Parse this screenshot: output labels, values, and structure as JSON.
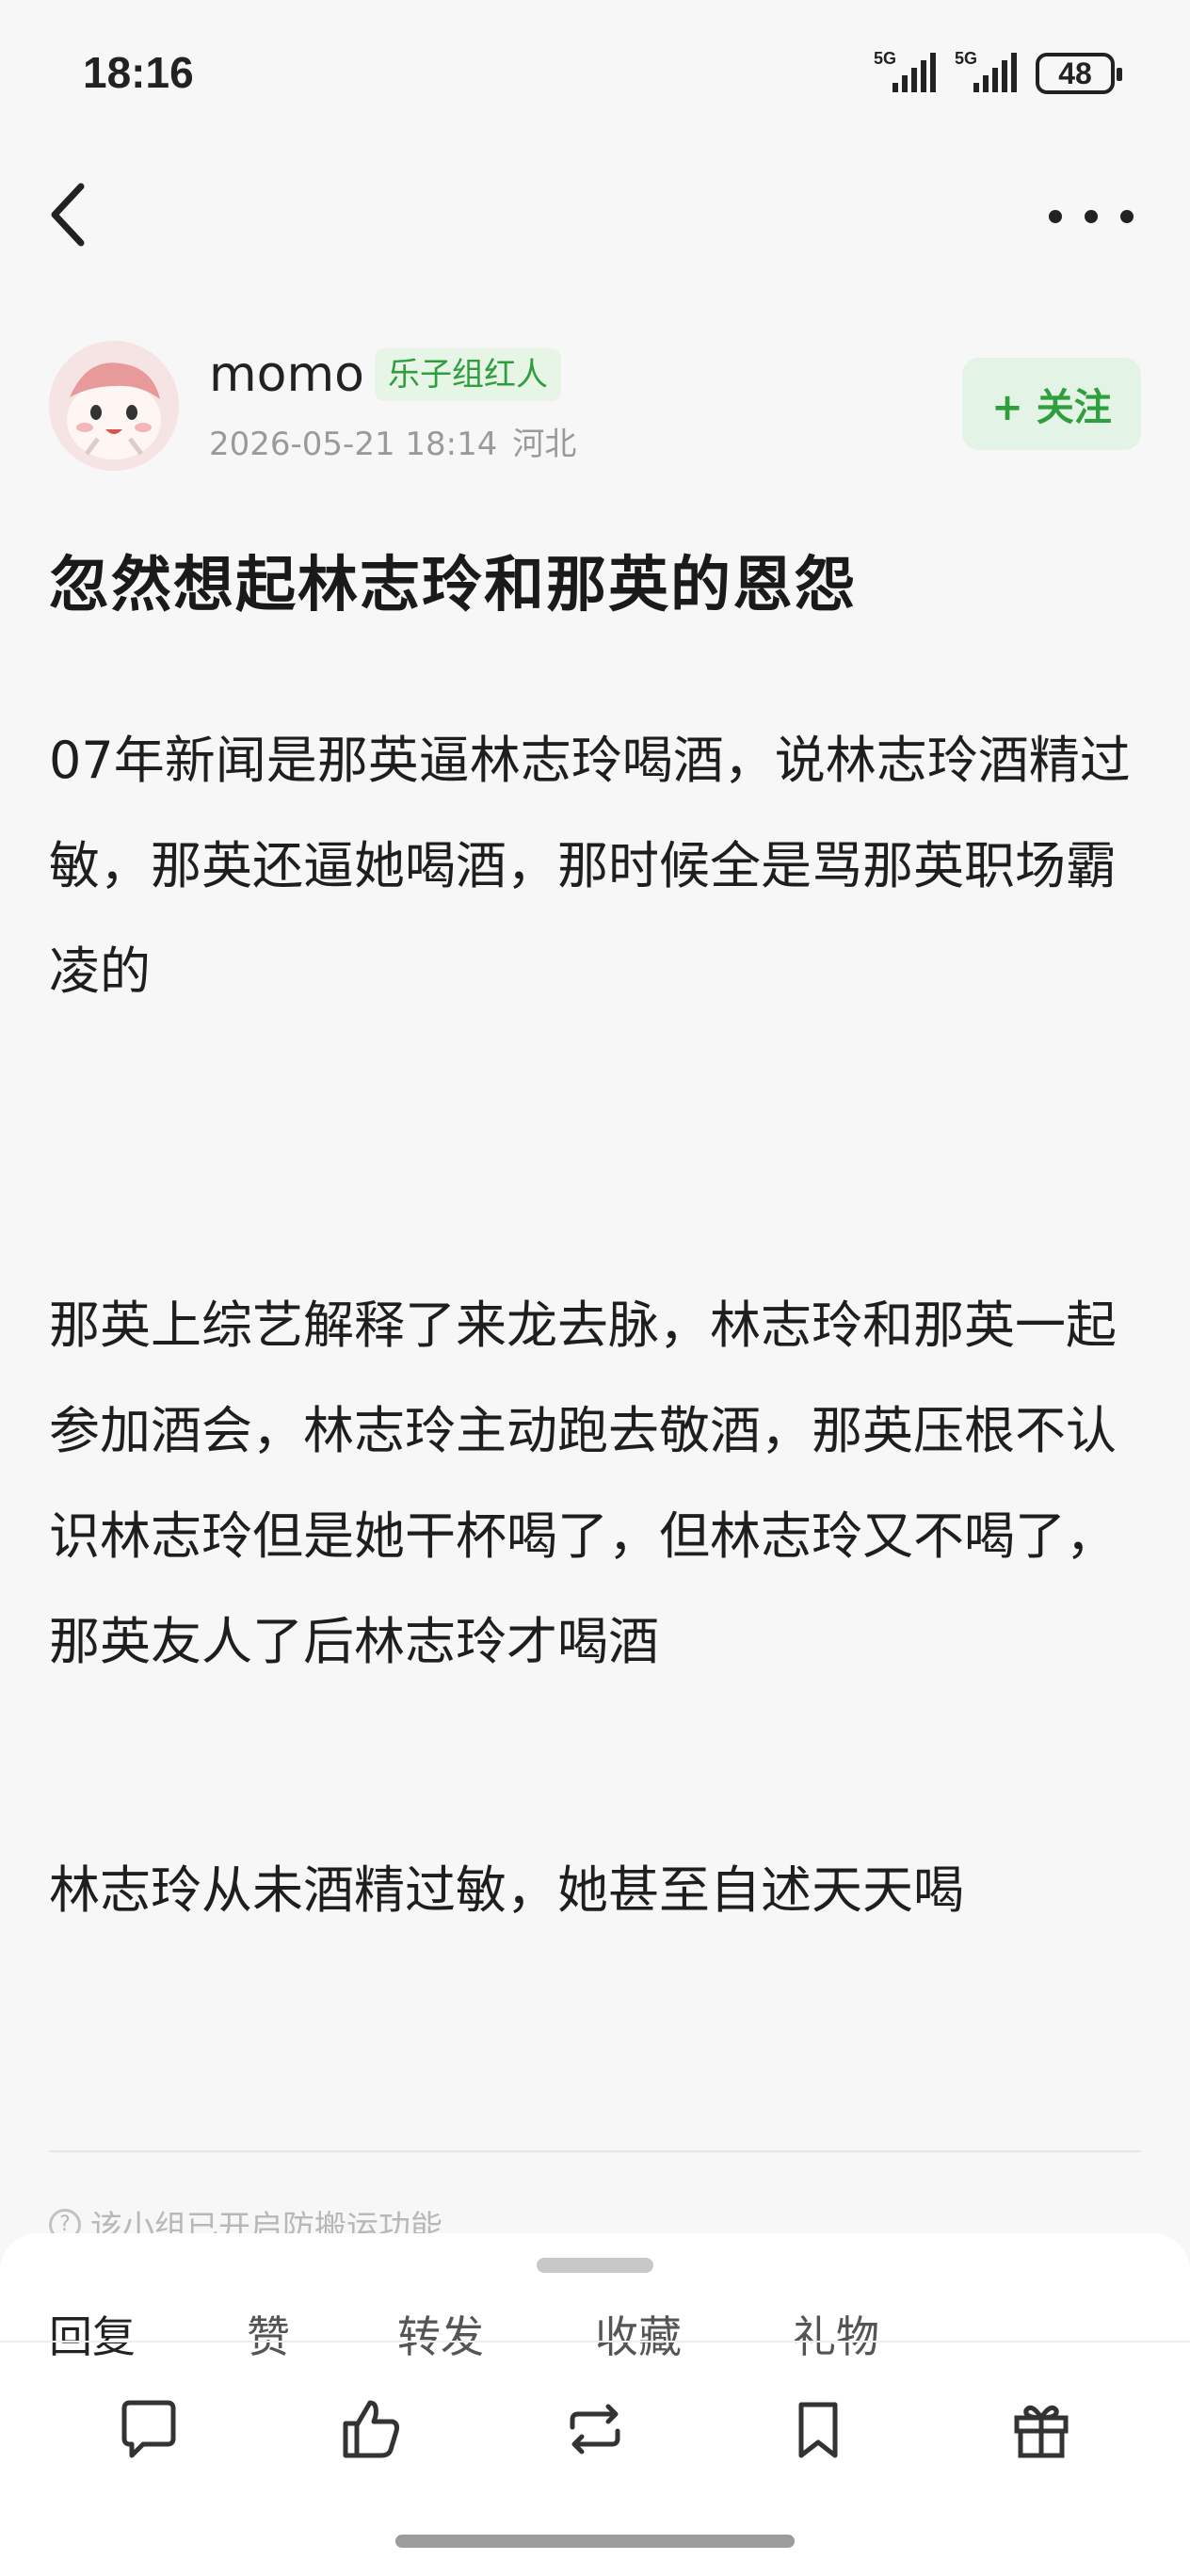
{
  "status_bar": {
    "time": "18:16",
    "signal1_label": "5G",
    "signal2_label": "5G",
    "battery": "48"
  },
  "nav": {
    "back_icon": "chevron-left-icon",
    "more_icon": "more-horizontal-icon"
  },
  "author": {
    "name": "momo",
    "badge": "乐子组红人",
    "timestamp": "2026-05-21 18:14",
    "location": "河北",
    "follow_label": "+ 关注",
    "badge_color": "#2f9e3d"
  },
  "post": {
    "title": "忽然想起林志玲和那英的恩怨",
    "paragraphs": [
      "07年新闻是那英逼林志玲喝酒，说林志玲酒精过敏，那英还逼她喝酒，那时候全是骂那英职场霸凌的",
      "那英上综艺解释了来龙去脉，林志玲和那英一起参加酒会，林志玲主动跑去敬酒，那英压根不认识林志玲但是她干杯喝了，但林志玲又不喝了，那英友人了后林志玲才喝酒",
      "林志玲从未酒精过敏，她甚至自述天天喝"
    ]
  },
  "footer_note": "该小组已开启防搬运功能",
  "bottom_sheet": {
    "tabs": [
      "回复",
      "赞",
      "转发",
      "收藏",
      "礼物"
    ],
    "tools": [
      "comment-icon",
      "like-icon",
      "repost-icon",
      "bookmark-icon",
      "gift-icon"
    ]
  }
}
